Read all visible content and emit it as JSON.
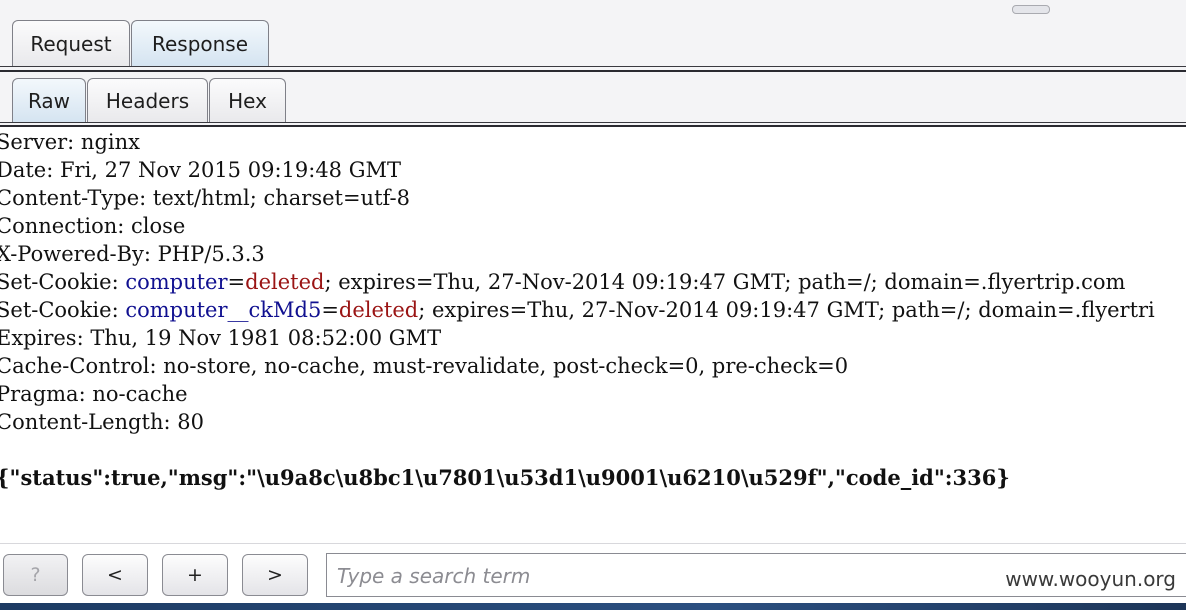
{
  "tabs": {
    "primary": [
      "Request",
      "Response"
    ],
    "primary_active": "Response",
    "secondary": [
      "Raw",
      "Headers",
      "Hex"
    ],
    "secondary_active": "Raw"
  },
  "response": {
    "headers": [
      "Server: nginx",
      "Date: Fri, 27 Nov 2015 09:19:48 GMT",
      "Content-Type: text/html; charset=utf-8",
      "Connection: close",
      "X-Powered-By: PHP/5.3.3"
    ],
    "cookies": [
      {
        "prefix": "Set-Cookie: ",
        "name": "computer",
        "eq": "=",
        "value": "deleted",
        "rest": "; expires=Thu, 27-Nov-2014 09:19:47 GMT; path=/; domain=.flyertrip.com"
      },
      {
        "prefix": "Set-Cookie: ",
        "name": "computer__ckMd5",
        "eq": "=",
        "value": "deleted",
        "rest": "; expires=Thu, 27-Nov-2014 09:19:47 GMT; path=/; domain=.flyertri"
      }
    ],
    "headers_after": [
      "Expires: Thu, 19 Nov 1981 08:52:00 GMT",
      "Cache-Control: no-store, no-cache, must-revalidate, post-check=0, pre-check=0",
      "Pragma: no-cache",
      "Content-Length: 80"
    ],
    "body": "{\"status\":true,\"msg\":\"\\u9a8c\\u8bc1\\u7801\\u53d1\\u9001\\u6210\\u529f\",\"code_id\":336}"
  },
  "toolbar": {
    "help_label": "?",
    "prev_label": "<",
    "add_label": "+",
    "next_label": ">",
    "search_placeholder": "Type a search term",
    "search_value": ""
  },
  "watermark": "www.wooyun.org",
  "colors": {
    "cookie_name": "#101090",
    "cookie_value": "#9a1414",
    "active_tab": "#d5e4f1"
  }
}
